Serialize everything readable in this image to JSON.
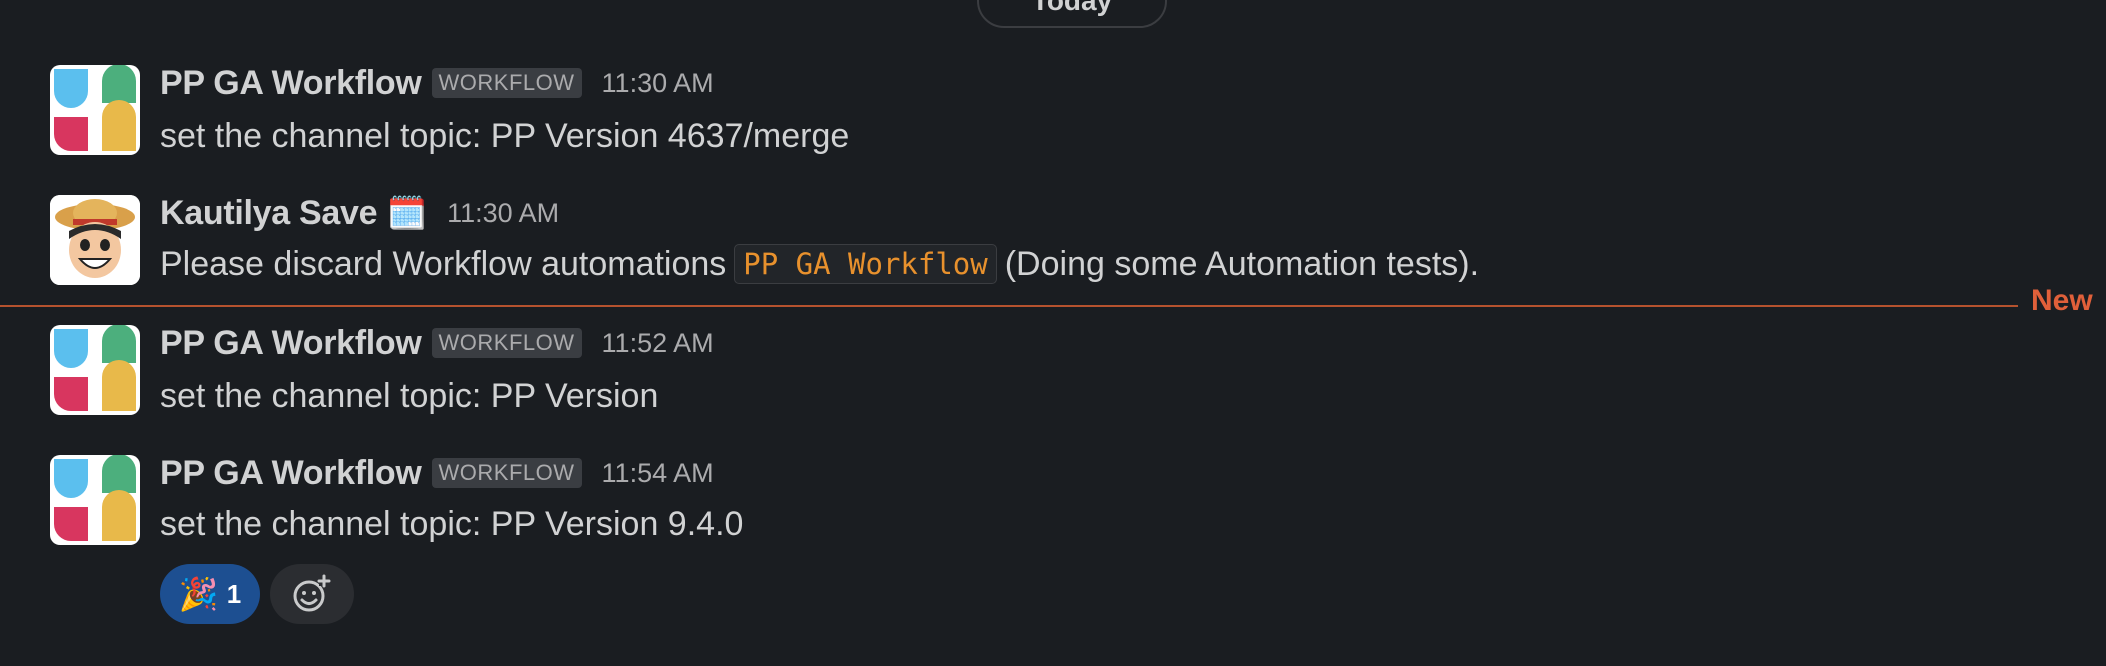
{
  "divider": {
    "day_label": "Today"
  },
  "messages": [
    {
      "sender": "PP GA Workflow",
      "badge": "WORKFLOW",
      "time": "11:30 AM",
      "text": "set the channel topic: PP Version 4637/merge",
      "avatar": "workflow-logo-icon"
    },
    {
      "sender": "Kautilya Save",
      "status_emoji": "🗓️",
      "time": "11:30 AM",
      "text_before": "Please discard Workflow automations",
      "code_chip": "PP GA Workflow",
      "text_after": "(Doing some Automation tests).",
      "avatar": "cartoon-avatar"
    },
    {
      "sender": "PP GA Workflow",
      "badge": "WORKFLOW",
      "time": "11:52 AM",
      "text": "set the channel topic: PP Version",
      "avatar": "workflow-logo-icon"
    },
    {
      "sender": "PP GA Workflow",
      "badge": "WORKFLOW",
      "time": "11:54 AM",
      "text": "set the channel topic: PP Version 9.4.0",
      "avatar": "workflow-logo-icon",
      "reactions": [
        {
          "emoji": "🎉",
          "count": "1",
          "icon": "party-popper-icon"
        }
      ]
    }
  ],
  "new_marker": {
    "label": "New",
    "color": "#e0603a"
  },
  "colors": {
    "background": "#1a1d21",
    "text": "#d1d2d3",
    "muted": "#ababad",
    "reaction_active": "#1d4f91",
    "code": "#e8912d"
  }
}
